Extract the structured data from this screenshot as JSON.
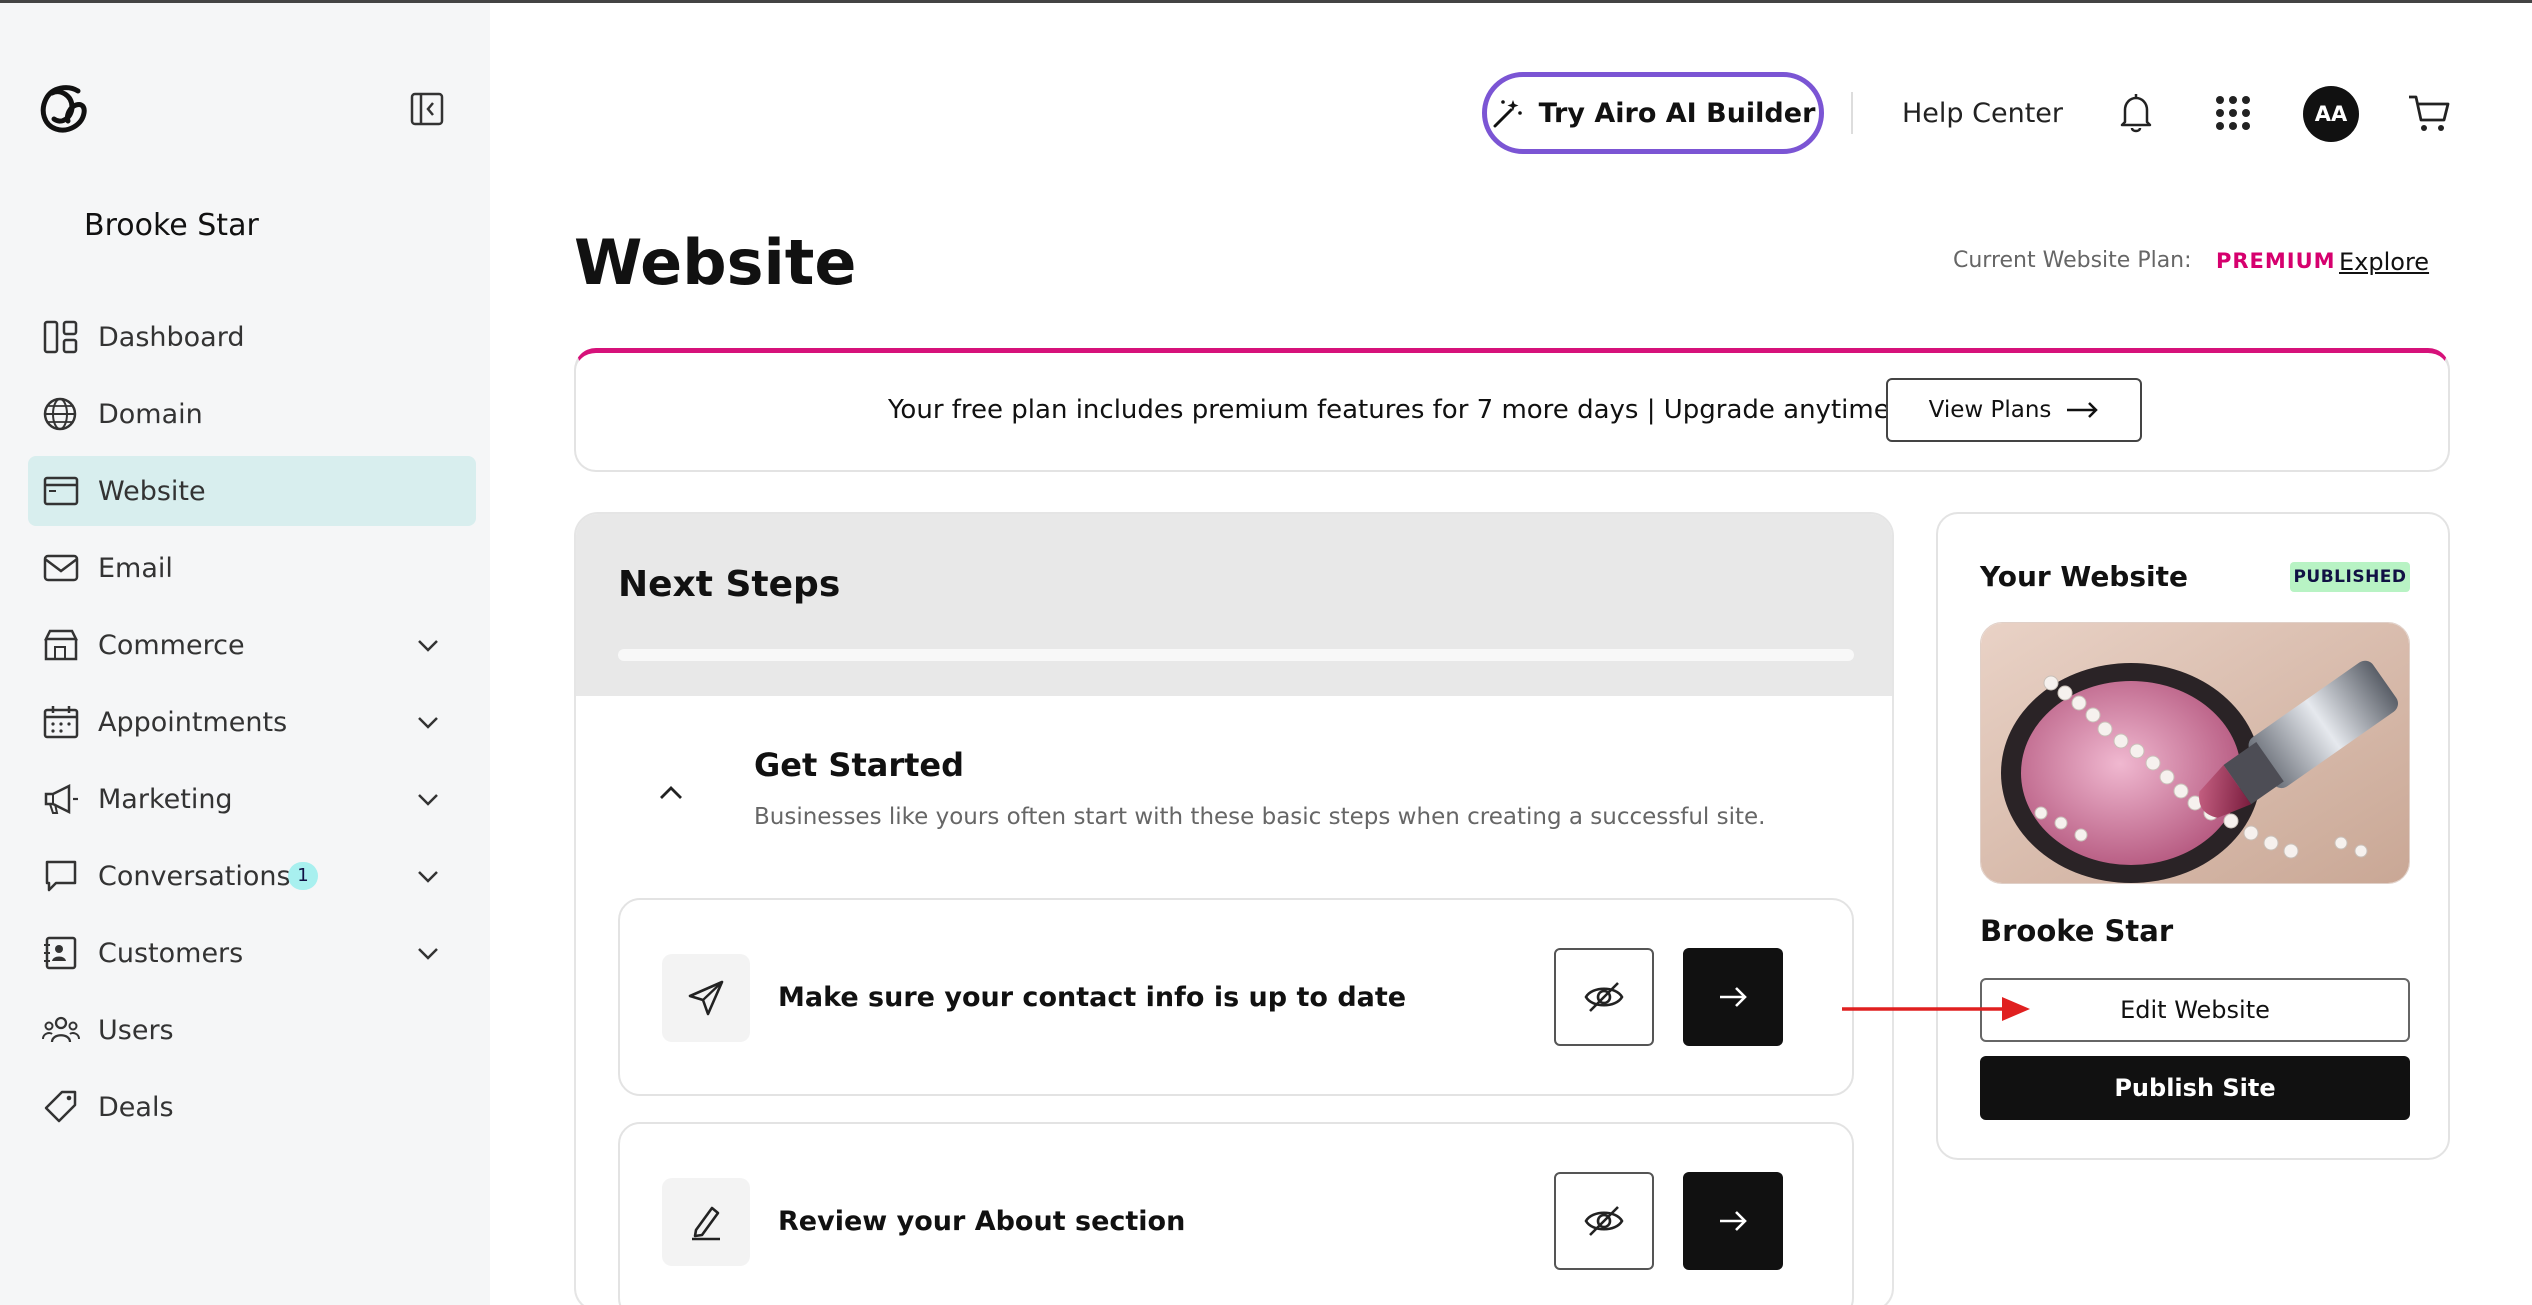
{
  "sidebar": {
    "account_name": "Brooke Star",
    "items": [
      {
        "label": "Dashboard",
        "icon": "dashboard-icon",
        "active": false,
        "expandable": false
      },
      {
        "label": "Domain",
        "icon": "globe-icon",
        "active": false,
        "expandable": false
      },
      {
        "label": "Website",
        "icon": "browser-window-icon",
        "active": true,
        "expandable": false
      },
      {
        "label": "Email",
        "icon": "envelope-icon",
        "active": false,
        "expandable": false
      },
      {
        "label": "Commerce",
        "icon": "storefront-icon",
        "active": false,
        "expandable": true
      },
      {
        "label": "Appointments",
        "icon": "calendar-icon",
        "active": false,
        "expandable": true
      },
      {
        "label": "Marketing",
        "icon": "megaphone-icon",
        "active": false,
        "expandable": true
      },
      {
        "label": "Conversations",
        "icon": "chat-bubble-icon",
        "active": false,
        "expandable": true,
        "badge": "1"
      },
      {
        "label": "Customers",
        "icon": "contact-card-icon",
        "active": false,
        "expandable": true
      },
      {
        "label": "Users",
        "icon": "users-icon",
        "active": false,
        "expandable": false
      },
      {
        "label": "Deals",
        "icon": "tag-icon",
        "active": false,
        "expandable": false
      }
    ]
  },
  "header": {
    "airo_button": "Try Airo AI Builder",
    "help_center": "Help Center",
    "avatar_initials": "AA"
  },
  "page": {
    "title": "Website",
    "plan_label": "Current Website Plan:",
    "plan_value": "PREMIUM",
    "explore": "Explore"
  },
  "banner": {
    "text": "Your free plan includes premium features for 7 more days  |  Upgrade anytime",
    "button": "View Plans"
  },
  "next_steps": {
    "title": "Next Steps",
    "section_title": "Get Started",
    "section_desc": "Businesses like yours often start with these basic steps when creating a successful site.",
    "tasks": [
      {
        "label": "Make sure your contact info is up to date",
        "icon": "paper-plane-icon"
      },
      {
        "label": "Review your About section",
        "icon": "pencil-icon"
      }
    ]
  },
  "your_website": {
    "title": "Your Website",
    "status": "PUBLISHED",
    "site_name": "Brooke Star",
    "edit_button": "Edit Website",
    "publish_button": "Publish Site"
  },
  "colors": {
    "accent_pink": "#d6117a",
    "airo_purple": "#7b55d4",
    "active_nav_bg": "#d8eeee",
    "published_badge": "#b8f3c4",
    "annotation_arrow": "#e02020"
  }
}
